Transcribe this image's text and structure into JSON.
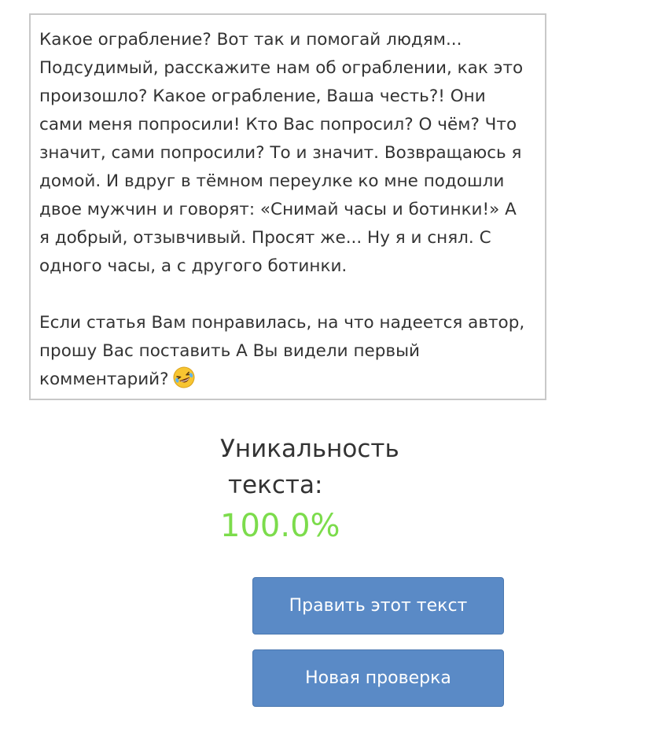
{
  "article": {
    "paragraph1": "Какое ограбление? Вот так и помогай людям... Подсудимый, расскажите нам об ограблении, как это произошло? Какое ограбление, Ваша честь?! Они сами меня попросили! Кто Вас попросил? О чём? Что значит, сами попросили? То и значит. Возвращаюсь я домой. И вдруг в тёмном переулке ко мне подошли двое мужчин и говорят: «Снимай часы и ботинки!» А я добрый, отзывчивый. Просят же... Ну я и снял. С одного часы, а с другого ботинки.",
    "paragraph2": "Если статья Вам понравилась, на что надеется автор, прошу Вас поставить А Вы видели первый комментарий?",
    "emoji_icon": "rolling-on-floor-laughing-emoji"
  },
  "uniqueness": {
    "label_line1": "Уникальность",
    "label_line2": "текста:",
    "value": "100.0%",
    "value_color": "#7cdc4c"
  },
  "actions": {
    "edit_label": "Править этот текст",
    "new_check_label": "Новая проверка",
    "button_color": "#5a8ac6"
  }
}
